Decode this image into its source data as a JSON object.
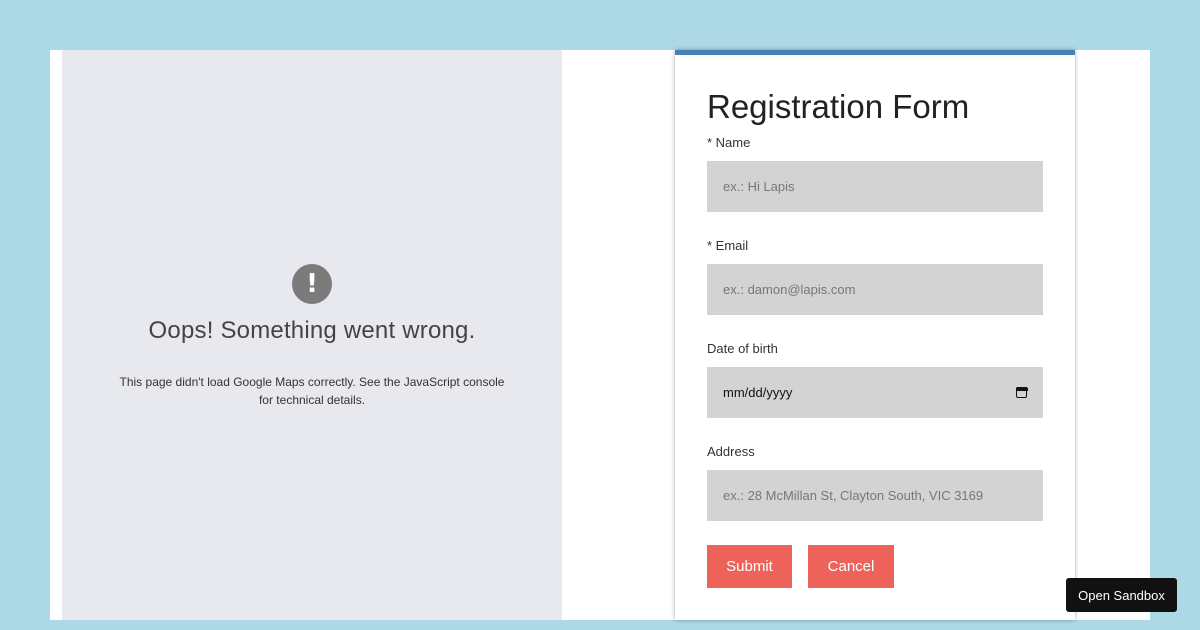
{
  "map": {
    "error_icon": "exclamation-icon",
    "error_glyph": "!",
    "error_title": "Oops! Something went wrong.",
    "error_message": "This page didn't load Google Maps correctly. See the JavaScript console for technical details."
  },
  "form": {
    "title": "Registration Form",
    "fields": {
      "name": {
        "label": "* Name",
        "placeholder": "ex.: Hi Lapis"
      },
      "email": {
        "label": "* Email",
        "placeholder": "ex.: damon@lapis.com"
      },
      "dob": {
        "label": "Date of birth",
        "value": "mm/dd/yyyy",
        "icon": "calendar-icon"
      },
      "address": {
        "label": "Address",
        "placeholder": "ex.: 28 McMillan St, Clayton South, VIC 3169"
      }
    },
    "submit_label": "Submit",
    "cancel_label": "Cancel"
  },
  "sandbox": {
    "label": "Open Sandbox"
  },
  "colors": {
    "background": "#add8e6",
    "accent": "#4682b4",
    "button": "#ed635a",
    "input_bg": "#d3d3d3",
    "map_bg": "#e8e9ee"
  }
}
